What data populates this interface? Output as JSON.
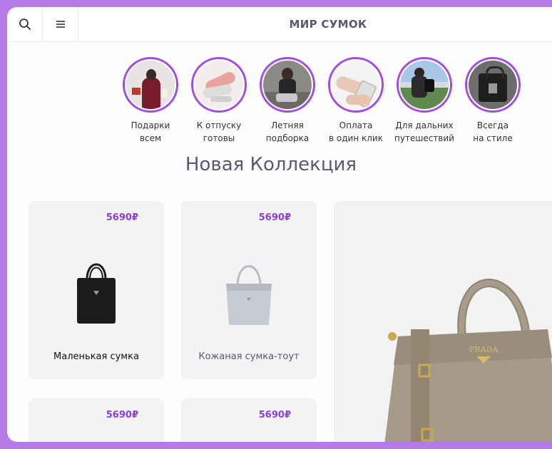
{
  "header": {
    "brand": "МИР СУМОК",
    "search_icon": "search-icon",
    "menu_icon": "menu-icon"
  },
  "stories": [
    {
      "line1": "Подарки",
      "line2": "всем"
    },
    {
      "line1": "К отпуску",
      "line2": "готовы"
    },
    {
      "line1": "Летняя",
      "line2": "подборка"
    },
    {
      "line1": "Оплата",
      "line2": "в один клик"
    },
    {
      "line1": "Для дальних",
      "line2": "путешествий"
    },
    {
      "line1": "Всегда",
      "line2": "на стиле"
    }
  ],
  "collection": {
    "title": "Новая Коллекция",
    "products": [
      {
        "price": "5690₽",
        "name": "Маленькая сумка"
      },
      {
        "price": "5690₽",
        "name": "Кожаная сумка-тоут"
      },
      {
        "price": "5690₽",
        "name": ""
      },
      {
        "price": "5690₽",
        "name": ""
      }
    ],
    "featured_brand": "PRADA"
  },
  "colors": {
    "accent": "#8b3fd9",
    "frame": "#b57ae8",
    "title": "#5b5877"
  }
}
